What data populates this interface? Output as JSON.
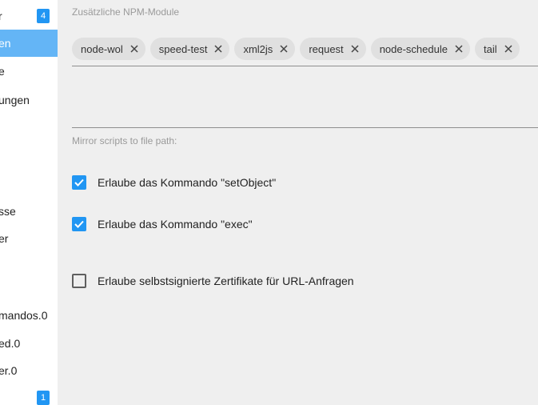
{
  "sidebar": {
    "items": [
      {
        "label": "r",
        "badge": "4",
        "active": false
      },
      {
        "label": "en",
        "badge": "",
        "active": true
      },
      {
        "label": "e",
        "badge": "",
        "active": false
      },
      {
        "label": "ungen",
        "badge": "",
        "active": false
      },
      {
        "label": "sse",
        "badge": "",
        "active": false
      },
      {
        "label": "er",
        "badge": "",
        "active": false
      },
      {
        "label": "mandos.0",
        "badge": "",
        "active": false
      },
      {
        "label": "ed.0",
        "badge": "",
        "active": false
      },
      {
        "label": "er.0",
        "badge": "",
        "active": false
      },
      {
        "label": "",
        "badge": "1",
        "active": false
      }
    ]
  },
  "npm": {
    "label": "Zusätzliche NPM-Module",
    "modules": [
      "node-wol",
      "speed-test",
      "xml2js",
      "request",
      "node-schedule",
      "tail"
    ]
  },
  "mirror": {
    "label": "Mirror scripts to file path:",
    "value": ""
  },
  "options": [
    {
      "label": "Erlaube das Kommando \"setObject\"",
      "checked": true
    },
    {
      "label": "Erlaube das Kommando \"exec\"",
      "checked": true
    },
    {
      "label": "Erlaube selbstsignierte Zertifikate für URL-Anfragen",
      "checked": false
    }
  ],
  "colors": {
    "accent": "#2196f3",
    "active_item": "#64b5f6"
  }
}
